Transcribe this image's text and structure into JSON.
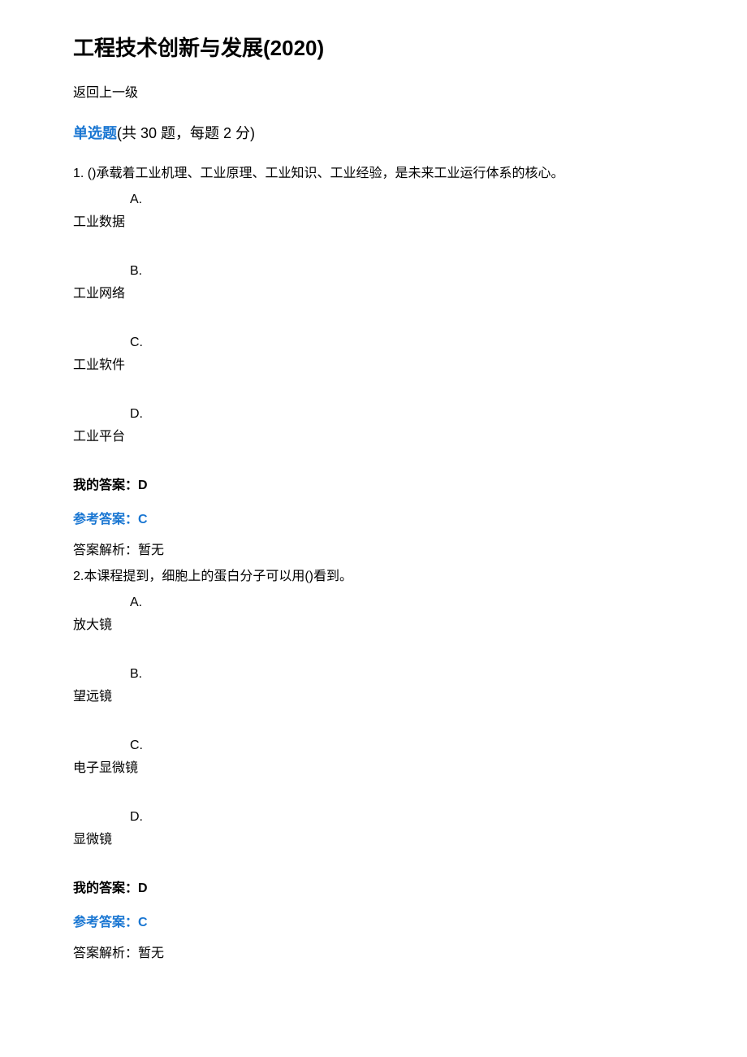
{
  "title": "工程技术创新与发展(2020)",
  "back_link": "返回上一级",
  "section": {
    "type_label": "单选题",
    "count_label": "(共 30 题，每题 2 分)"
  },
  "questions": [
    {
      "number": "1.",
      "stem": "()承载着工业机理、工业原理、工业知识、工业经验，是未来工业运行体系的核心。",
      "options": [
        {
          "letter": "A.",
          "text": "工业数据"
        },
        {
          "letter": "B.",
          "text": "工业网络"
        },
        {
          "letter": "C.",
          "text": "工业软件"
        },
        {
          "letter": "D.",
          "text": "工业平台"
        }
      ],
      "my_answer_label": "我的答案：",
      "my_answer_value": "D",
      "ref_answer_label": "参考答案：",
      "ref_answer_value": "C",
      "analysis_label": "答案解析：",
      "analysis_value": "暂无"
    },
    {
      "number": "2.",
      "stem": "本课程提到，细胞上的蛋白分子可以用()看到。",
      "options": [
        {
          "letter": "A.",
          "text": "放大镜"
        },
        {
          "letter": "B.",
          "text": "望远镜"
        },
        {
          "letter": "C.",
          "text": "电子显微镜"
        },
        {
          "letter": "D.",
          "text": "显微镜"
        }
      ],
      "my_answer_label": "我的答案：",
      "my_answer_value": "D",
      "ref_answer_label": "参考答案：",
      "ref_answer_value": "C",
      "analysis_label": "答案解析：",
      "analysis_value": "暂无"
    }
  ]
}
